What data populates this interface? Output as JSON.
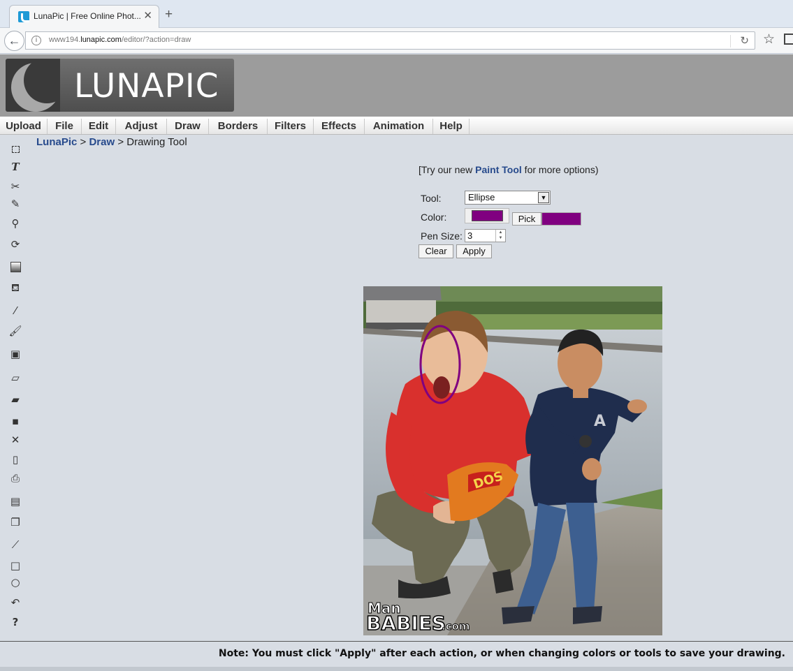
{
  "browser": {
    "tab_title": "LunaPic | Free Online Phot...",
    "tab_close": "✕",
    "new_tab": "+",
    "url_prefix": "www194.",
    "url_domain": "lunapic.com",
    "url_path": "/editor/?action=draw"
  },
  "logo": {
    "text": "LUNAPIC"
  },
  "menu": [
    "Upload",
    "File",
    "Edit",
    "Adjust",
    "Draw",
    "Borders",
    "Filters",
    "Effects",
    "Animation",
    "Help"
  ],
  "toolbar_icons": [
    "select-icon",
    "text-icon",
    "scissors-icon",
    "pencil-icon",
    "zoom-icon",
    "rotate-icon",
    "gradient-icon",
    "fill-bucket-icon",
    "eyedropper-icon",
    "brush-icon",
    "layers-icon",
    "eraser-icon",
    "open-folder-icon",
    "save-icon",
    "close-icon",
    "new-page-icon",
    "print-icon",
    "paste-icon",
    "copy-icon",
    "line-icon",
    "rectangle-icon",
    "circle-icon",
    "undo-icon",
    "help-icon"
  ],
  "breadcrumb": {
    "root": "LunaPic",
    "sep1": " > ",
    "section": "Draw",
    "sep2": " > ",
    "current": "Drawing Tool"
  },
  "promo": {
    "before": "[Try our new ",
    "link": "Paint Tool",
    "after": " for more options)"
  },
  "form": {
    "tool_label": "Tool:",
    "tool_value": "Ellipse",
    "color_label": "Color:",
    "color_hex": "#800080",
    "pick_label": "Pick",
    "pen_label": "Pen Size:",
    "pen_value": "3",
    "clear_label": "Clear",
    "apply_label": "Apply"
  },
  "photo": {
    "watermark_top": "Man",
    "watermark_main": "BABIES",
    "watermark_suffix": ".com",
    "bag_text": "DOS"
  },
  "footer": {
    "note": "Note: You must click \"Apply\" after each action, or when changing colors or tools to save your drawing."
  }
}
